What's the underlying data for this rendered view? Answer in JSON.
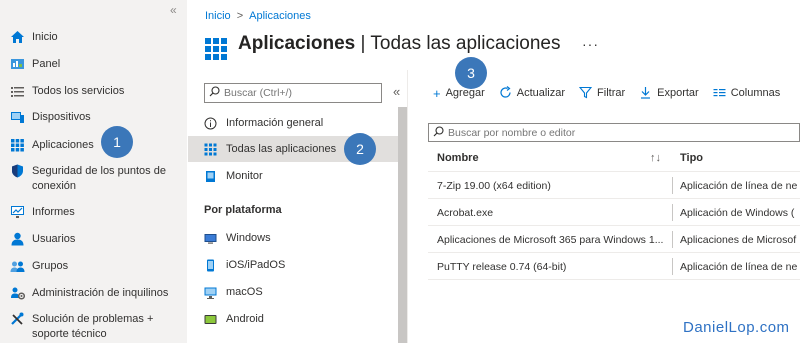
{
  "colors": {
    "accent": "#0078d4",
    "badge": "#3b77b9",
    "nav_bg": "#f3f2f1"
  },
  "leftnav": {
    "collapse_icon": "double-chevron-left-icon",
    "items": [
      {
        "label": "Inicio",
        "icon": "home-icon"
      },
      {
        "label": "Panel",
        "icon": "dashboard-icon"
      },
      {
        "label": "Todos los servicios",
        "icon": "list-icon"
      },
      {
        "label": "Dispositivos",
        "icon": "devices-icon"
      },
      {
        "label": "Aplicaciones",
        "icon": "apps-grid-icon"
      },
      {
        "label": "Seguridad de los puntos de conexión",
        "icon": "shield-icon"
      },
      {
        "label": "Informes",
        "icon": "reports-icon"
      },
      {
        "label": "Usuarios",
        "icon": "user-icon"
      },
      {
        "label": "Grupos",
        "icon": "groups-icon"
      },
      {
        "label": "Administración de inquilinos",
        "icon": "tenant-gear-icon"
      },
      {
        "label": "Solución de problemas + soporte técnico",
        "icon": "tools-icon"
      }
    ]
  },
  "breadcrumb": {
    "home": "Inicio",
    "separator": ">",
    "current": "Aplicaciones"
  },
  "header": {
    "title_bold": "Aplicaciones",
    "title_sep": " | ",
    "title_rest": "Todas las aplicaciones",
    "more": "···"
  },
  "resource_menu": {
    "search_placeholder": "Buscar (Ctrl+/)",
    "collapse": "«",
    "items": [
      {
        "label": "Información general",
        "icon": "info-icon"
      },
      {
        "label": "Todas las aplicaciones",
        "icon": "apps-grid-icon"
      },
      {
        "label": "Monitor",
        "icon": "monitor-icon"
      }
    ],
    "section_title": "Por plataforma",
    "platforms": [
      {
        "label": "Windows",
        "icon": "windows-icon"
      },
      {
        "label": "iOS/iPadOS",
        "icon": "ios-icon"
      },
      {
        "label": "macOS",
        "icon": "macos-icon"
      },
      {
        "label": "Android",
        "icon": "android-icon"
      }
    ]
  },
  "toolbar": {
    "add": "Agregar",
    "refresh": "Actualizar",
    "filter": "Filtrar",
    "export": "Exportar",
    "columns": "Columnas"
  },
  "list": {
    "search_placeholder": "Buscar por nombre o editor",
    "columns": {
      "name": "Nombre",
      "type": "Tipo"
    },
    "rows": [
      {
        "name": "7-Zip 19.00 (x64 edition)",
        "type": "Aplicación de línea de ne"
      },
      {
        "name": "Acrobat.exe",
        "type": "Aplicación de Windows ("
      },
      {
        "name": "Aplicaciones de Microsoft 365 para Windows 1...",
        "type": "Aplicaciones de Microsof"
      },
      {
        "name": "PuTTY release 0.74 (64-bit)",
        "type": "Aplicación de línea de ne"
      }
    ]
  },
  "badges": [
    "1",
    "2",
    "3"
  ],
  "watermark": "DanielLop.com"
}
